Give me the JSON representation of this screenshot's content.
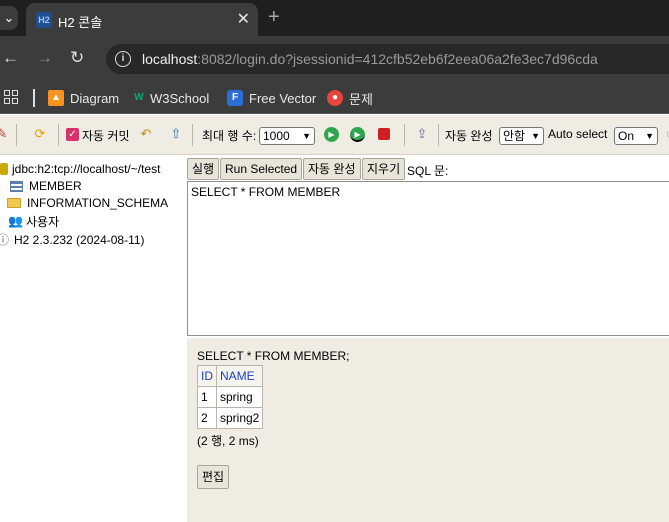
{
  "browser": {
    "tab_title": "H2 콘솔",
    "tab_favicon": "H2",
    "url_host": "localhost",
    "url_rest": ":8082/login.do?jsessionid=412cfb52eb6f2eea06a2fe3ec7d96cda",
    "bookmarks": [
      {
        "label": "Diagram",
        "icon": "diagram-icon",
        "color": "#f7931e"
      },
      {
        "label": "W3School",
        "icon": "w3school-icon",
        "color": "#04aa6d"
      },
      {
        "label": "Free Vector",
        "icon": "freevector-icon",
        "color": "#2b6fd6"
      },
      {
        "label": "문제",
        "icon": "problem-icon",
        "color": "#e8453c"
      }
    ]
  },
  "toolbar": {
    "auto_commit_label": "자동 커밋",
    "max_rows_label": "최대 행 수:",
    "max_rows_value": "1000",
    "auto_complete_label": "자동 완성",
    "auto_complete_value": "안함",
    "auto_select_label": "Auto select",
    "auto_select_value": "On"
  },
  "tree": {
    "connection": "jdbc:h2:tcp://localhost/~/test",
    "items": [
      "MEMBER",
      "INFORMATION_SCHEMA",
      "사용자"
    ],
    "version": "H2 2.3.232 (2024-08-11)"
  },
  "query": {
    "run_label": "실행",
    "run_selected_label": "Run Selected",
    "auto_complete_button": "자동 완성",
    "clear_label": "지우기",
    "sql_label": "SQL 문:",
    "sql_text": "SELECT * FROM MEMBER"
  },
  "result": {
    "sql": "SELECT * FROM MEMBER;",
    "columns": [
      "ID",
      "NAME"
    ],
    "rows": [
      [
        "1",
        "spring"
      ],
      [
        "2",
        "spring2"
      ]
    ],
    "summary": "(2 행, 2 ms)",
    "edit_label": "편집"
  },
  "colors": {
    "column_header": "#1a3fcc",
    "panel_bg": "#efece4",
    "chrome_bg": "#3c3c3c"
  }
}
